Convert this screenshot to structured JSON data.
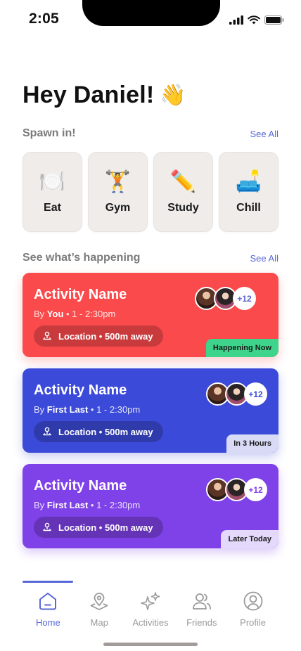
{
  "status": {
    "time": "2:05"
  },
  "greeting": {
    "text": "Hey Daniel!",
    "emoji": "👋"
  },
  "spawn": {
    "title": "Spawn in!",
    "see_all": "See All",
    "categories": [
      {
        "label": "Eat",
        "emoji": "🍽️"
      },
      {
        "label": "Gym",
        "emoji": "🏋️"
      },
      {
        "label": "Study",
        "emoji": "✏️"
      },
      {
        "label": "Chill",
        "emoji": "🛋️"
      }
    ]
  },
  "happening": {
    "title": "See what’s happening",
    "see_all": "See All",
    "activities": [
      {
        "name": "Activity Name",
        "by_prefix": "By ",
        "host": "You",
        "time": " • 1 - 2:30pm",
        "location": "Location • 500m away",
        "more": "+12",
        "tag": "Happening Now",
        "color": "#fa4a4c"
      },
      {
        "name": "Activity Name",
        "by_prefix": "By ",
        "host": "First Last",
        "time": " • 1 - 2:30pm",
        "location": "Location • 500m away",
        "more": "+12",
        "tag": "In 3 Hours",
        "color": "#3c4ad9"
      },
      {
        "name": "Activity Name",
        "by_prefix": "By ",
        "host": "First Last",
        "time": " • 1 - 2:30pm",
        "location": "Location • 500m away",
        "more": "+12",
        "tag": "Later Today",
        "color": "#7f42e8"
      }
    ]
  },
  "nav": {
    "accent": "#5867d6",
    "items": [
      {
        "label": "Home",
        "icon": "home-icon"
      },
      {
        "label": "Map",
        "icon": "map-pin-icon"
      },
      {
        "label": "Activities",
        "icon": "sparkles-icon"
      },
      {
        "label": "Friends",
        "icon": "friends-icon"
      },
      {
        "label": "Profile",
        "icon": "profile-icon"
      }
    ]
  }
}
